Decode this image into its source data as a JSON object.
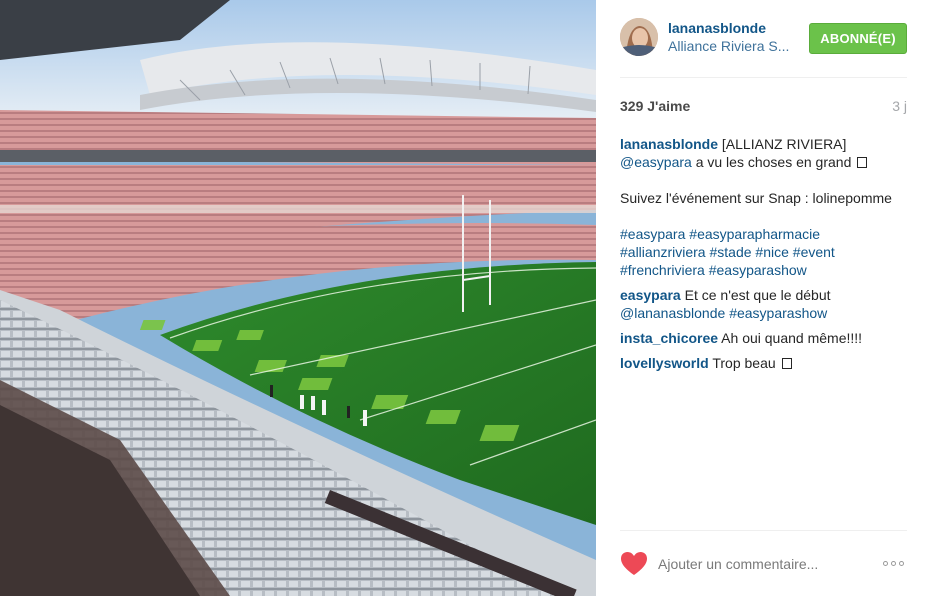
{
  "post": {
    "image_alt": "Alliance Riviera stadium interior with pink seats and green pitch",
    "author": {
      "username": "lananasblonde",
      "location": "Alliance Riviera S..."
    },
    "follow_label": "ABONNÉ(E)",
    "likes": "329 J'aime",
    "time": "3 j",
    "caption": {
      "user": "lananasblonde",
      "line1_text": " [ALLIANZ RIVIERA]",
      "mention": "@easypara",
      "line2_text": " a vu les choses en grand ",
      "line3": "Suivez l'événement sur Snap : lolinepomme",
      "hashtags_line1": [
        "#easypara",
        "#easyparapharmacie"
      ],
      "hashtags_line2": [
        "#allianzriviera",
        "#stade",
        "#nice",
        "#event"
      ],
      "hashtags_line3": [
        "#frenchriviera",
        "#easyparashow"
      ]
    },
    "comments": [
      {
        "user": "easypara",
        "text": " Et ce n'est que le début",
        "tags": [
          "@lananasblonde",
          "#easyparashow"
        ]
      },
      {
        "user": "insta_chicoree",
        "text": " Ah oui quand même!!!!"
      },
      {
        "user": "lovellysworld",
        "text": " Trop beau "
      }
    ],
    "comment_placeholder": "Ajouter un commentaire...",
    "icons": {
      "like": "heart-icon",
      "more": "more-options-icon"
    },
    "colors": {
      "link": "#125688",
      "follow_button": "#6bc24a",
      "heart": "#ed4956"
    }
  }
}
